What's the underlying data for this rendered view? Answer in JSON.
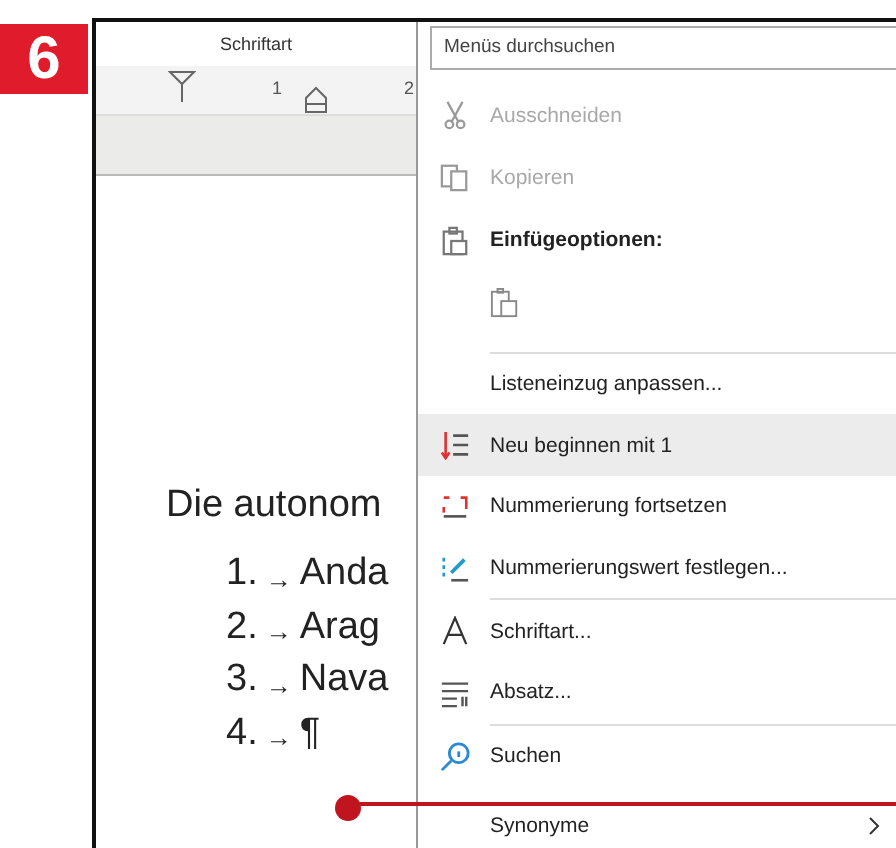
{
  "step_badge": "6",
  "word_pane": {
    "title": "Schriftart",
    "ruler_numbers": [
      "1",
      "2"
    ],
    "intro": "Die autonom",
    "list": [
      {
        "number": "1.",
        "tab_mark": "→",
        "text": "Anda"
      },
      {
        "number": "2.",
        "tab_mark": "→",
        "text": "Arag"
      },
      {
        "number": "3.",
        "tab_mark": "→",
        "text": "Nava"
      },
      {
        "number": "4.",
        "tab_mark": "→",
        "text": "¶"
      }
    ]
  },
  "context_menu": {
    "search": {
      "placeholder": "Menüs durchsuchen"
    },
    "items": [
      {
        "kind": "item",
        "label": "Ausschneiden",
        "disabled": true,
        "selected": false
      },
      {
        "kind": "item",
        "label": "Kopieren",
        "disabled": true,
        "selected": false
      },
      {
        "kind": "header",
        "label": "Einfügeoptionen:"
      },
      {
        "kind": "paste-option"
      },
      {
        "kind": "separator"
      },
      {
        "kind": "item",
        "label": "Listeneinzug anpassen...",
        "disabled": false,
        "selected": false
      },
      {
        "kind": "item",
        "label": "Neu beginnen mit 1",
        "disabled": false,
        "selected": true
      },
      {
        "kind": "item",
        "label": "Nummerierung fortsetzen",
        "disabled": false,
        "selected": false
      },
      {
        "kind": "item",
        "label": "Nummerierungswert festlegen...",
        "disabled": false,
        "selected": false
      },
      {
        "kind": "separator"
      },
      {
        "kind": "item",
        "label": "Schriftart...",
        "disabled": false,
        "selected": false
      },
      {
        "kind": "item",
        "label": "Absatz...",
        "disabled": false,
        "selected": false
      },
      {
        "kind": "separator"
      },
      {
        "kind": "item",
        "label": "Suchen",
        "disabled": false,
        "selected": false
      },
      {
        "kind": "item",
        "label": "Synonyme",
        "disabled": false,
        "selected": false,
        "submenu": true
      }
    ]
  }
}
